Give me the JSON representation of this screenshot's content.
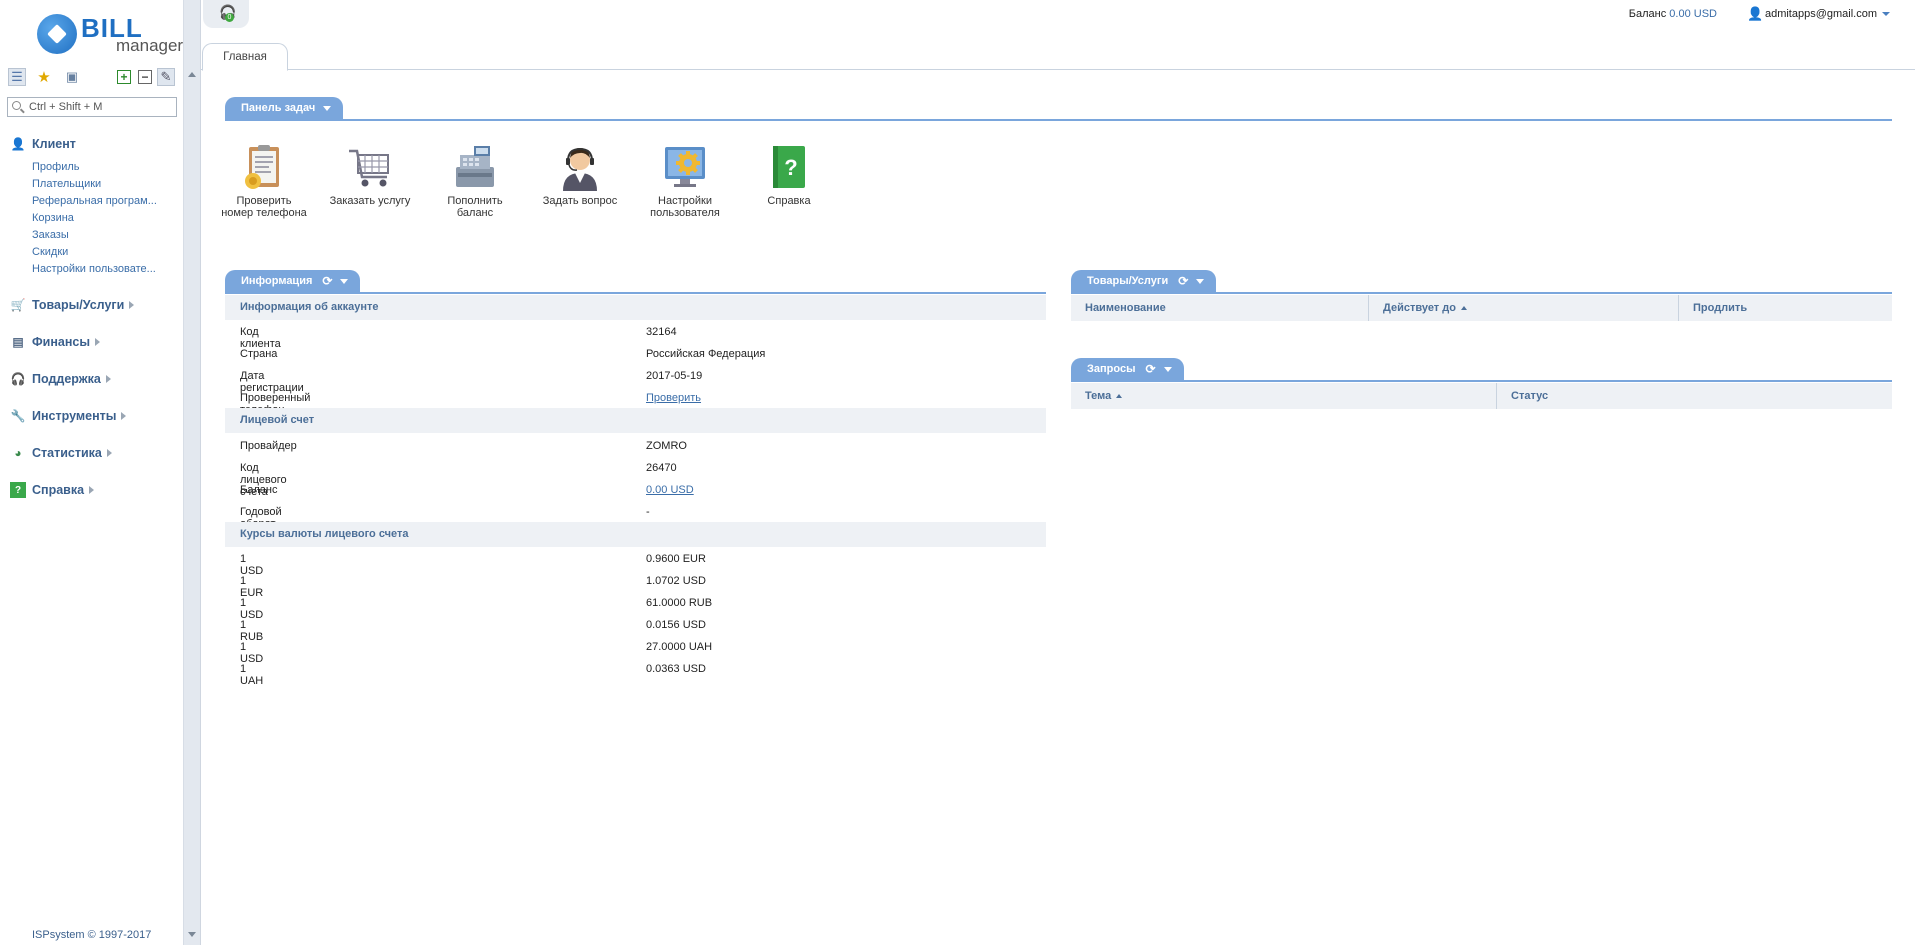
{
  "brand": {
    "logo_main": "BILL",
    "logo_sub": "manager"
  },
  "sidebar": {
    "search_placeholder": "Ctrl + Shift + M",
    "groups": [
      {
        "label": "Клиент",
        "items": [
          "Профиль",
          "Плательщики",
          "Реферальная програм...",
          "Корзина",
          "Заказы",
          "Скидки",
          "Настройки пользовате..."
        ]
      },
      {
        "label": "Товары/Услуги"
      },
      {
        "label": "Финансы"
      },
      {
        "label": "Поддержка"
      },
      {
        "label": "Инструменты"
      },
      {
        "label": "Статистика"
      },
      {
        "label": "Справка"
      }
    ],
    "footer": "ISPsystem © 1997-2017"
  },
  "topbar": {
    "notification_count": "0",
    "balance_label": "Баланс",
    "balance_value": "0.00 USD",
    "user": "admitapps@gmail.com",
    "tab_main": "Главная"
  },
  "taskbar": {
    "title": "Панель задач",
    "tasks": [
      {
        "label": "Проверить номер телефона",
        "icon": "clipboard-icon"
      },
      {
        "label": "Заказать услугу",
        "icon": "cart-icon"
      },
      {
        "label": "Пополнить баланс",
        "icon": "cash-register-icon"
      },
      {
        "label": "Задать вопрос",
        "icon": "support-agent-icon"
      },
      {
        "label": "Настройки пользователя",
        "icon": "settings-gear-icon"
      },
      {
        "label": "Справка",
        "icon": "help-book-icon"
      }
    ]
  },
  "info": {
    "title": "Информация",
    "account_section": "Информация об аккаунте",
    "account_rows": [
      {
        "key": "Код клиента",
        "value": "32164"
      },
      {
        "key": "Страна",
        "value": "Российская Федерация"
      },
      {
        "key": "Дата регистрации",
        "value": "2017-05-19"
      },
      {
        "key": "Проверенный телефон",
        "value": "Проверить"
      }
    ],
    "ledger_section": "Лицевой счет",
    "ledger_rows": [
      {
        "key": "Провайдер",
        "value": "ZOMRO"
      },
      {
        "key": "Код лицевого счета",
        "value": "26470"
      },
      {
        "key": "Баланс",
        "value": "0.00 USD"
      },
      {
        "key": "Годовой оборот",
        "value": "-"
      }
    ],
    "rates_section": "Курсы валюты лицевого счета",
    "rates_rows": [
      {
        "key": "1 USD",
        "value": "0.9600 EUR"
      },
      {
        "key": "1 EUR",
        "value": "1.0702 USD"
      },
      {
        "key": "1 USD",
        "value": "61.0000 RUB"
      },
      {
        "key": "1 RUB",
        "value": "0.0156 USD"
      },
      {
        "key": "1 USD",
        "value": "27.0000 UAH"
      },
      {
        "key": "1 UAH",
        "value": "0.0363 USD"
      }
    ]
  },
  "services": {
    "title": "Товары/Услуги",
    "columns": [
      "Наименование",
      "Действует до",
      "Продлить"
    ]
  },
  "requests": {
    "title": "Запросы",
    "columns": [
      "Тема",
      "Статус"
    ]
  },
  "colors": {
    "accent": "#7aa6dc",
    "link": "#3a6da8",
    "header_text": "#4c6f98"
  }
}
